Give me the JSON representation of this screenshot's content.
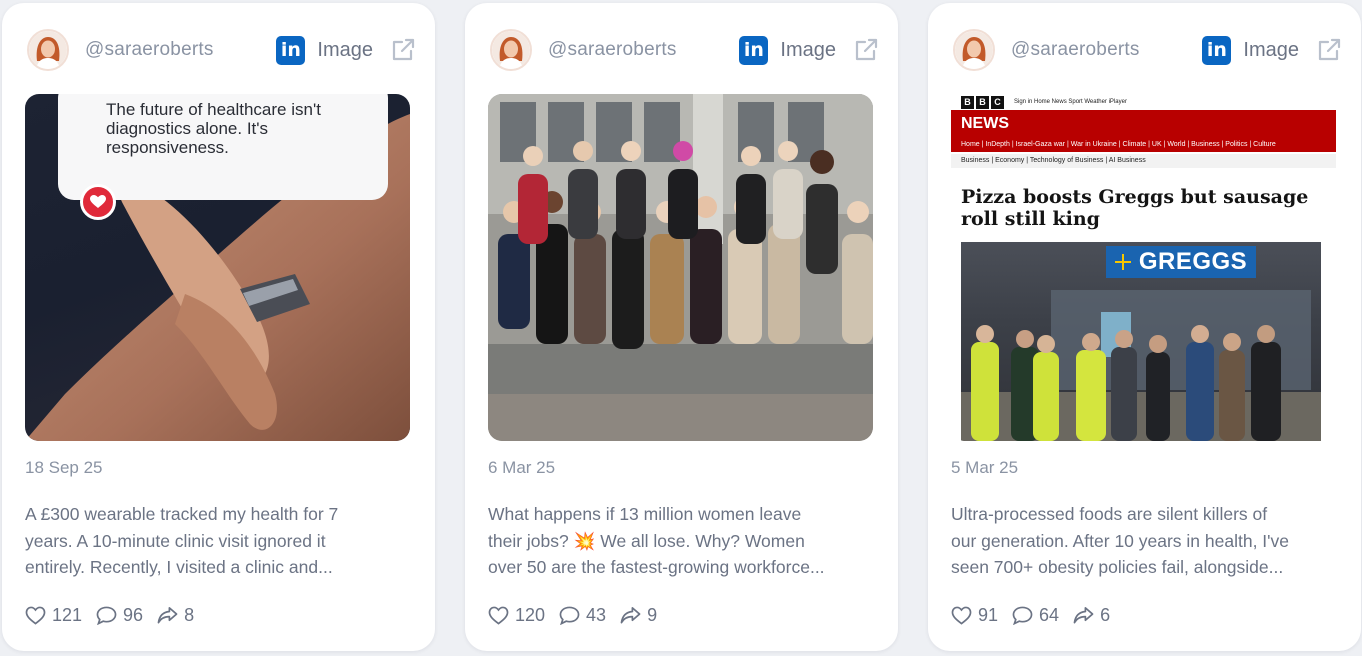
{
  "colors": {
    "page_bg": "#eef0f4",
    "card_bg": "#ffffff",
    "linkedin_blue": "#0a66c2",
    "muted_text": "#8a93a3",
    "body_text": "#6b7384",
    "bbc_red": "#b80000"
  },
  "cards": [
    {
      "username": "@saraeroberts",
      "network_icon": "linkedin-icon",
      "network_icon_letters": "in",
      "media_type": "Image",
      "date": "18 Sep 25",
      "image": {
        "overlay_text": "The future of healthcare isn't diagnostics alone. It's responsiveness."
      },
      "excerpt_lines": [
        "A £300 wearable tracked my health for 7",
        "years. A 10-minute clinic visit ignored it",
        "entirely. Recently, I visited a clinic and..."
      ],
      "likes": "121",
      "comments": "96",
      "shares": "8"
    },
    {
      "username": "@saraeroberts",
      "network_icon": "linkedin-icon",
      "network_icon_letters": "in",
      "media_type": "Image",
      "date": "6 Mar 25",
      "excerpt_lines": [
        "What happens if 13 million women leave",
        "their jobs? 💥 We all lose. Why? Women",
        "over 50 are the fastest-growing workforce..."
      ],
      "likes": "120",
      "comments": "43",
      "shares": "9"
    },
    {
      "username": "@saraeroberts",
      "network_icon": "linkedin-icon",
      "network_icon_letters": "in",
      "media_type": "Image",
      "date": "5 Mar 25",
      "image": {
        "bbc_logo_letters": [
          "B",
          "B",
          "C"
        ],
        "bbc_top_links": "Sign in   Home   News   Sport   Weather   iPlayer",
        "bbc_section": "NEWS",
        "bbc_nav": "Home | InDepth | Israel-Gaza war | War in Ukraine | Climate | UK | World | Business | Politics | Culture",
        "bbc_subnav": "Business | Economy | Technology of Business | AI Business",
        "headline": "Pizza boosts Greggs but sausage roll still king",
        "shop_sign": "GREGGS"
      },
      "excerpt_lines": [
        "Ultra-processed foods are silent killers of",
        "our generation. After 10 years in health, I've",
        "seen 700+ obesity policies fail, alongside..."
      ],
      "likes": "91",
      "comments": "64",
      "shares": "6"
    }
  ]
}
